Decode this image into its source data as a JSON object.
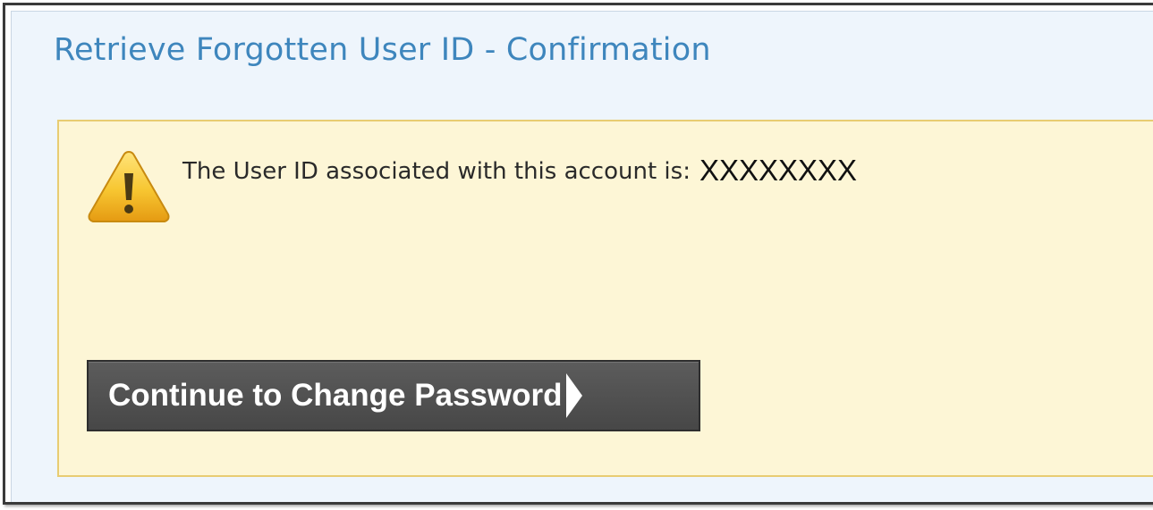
{
  "page": {
    "title": "Retrieve Forgotten User ID - Confirmation"
  },
  "alert": {
    "icon": "warning-icon",
    "message": "The User ID associated with this account is:",
    "user_id": "XXXXXXXX"
  },
  "actions": {
    "continue_label": "Continue to Change Password",
    "continue_icon": "arrow-right-icon"
  },
  "colors": {
    "title": "#3e86bd",
    "panel_background": "#eef5fc",
    "alert_background": "#fdf6d6",
    "alert_border": "#e8cc72",
    "button_background": "#4f4f4f",
    "button_text": "#ffffff"
  }
}
